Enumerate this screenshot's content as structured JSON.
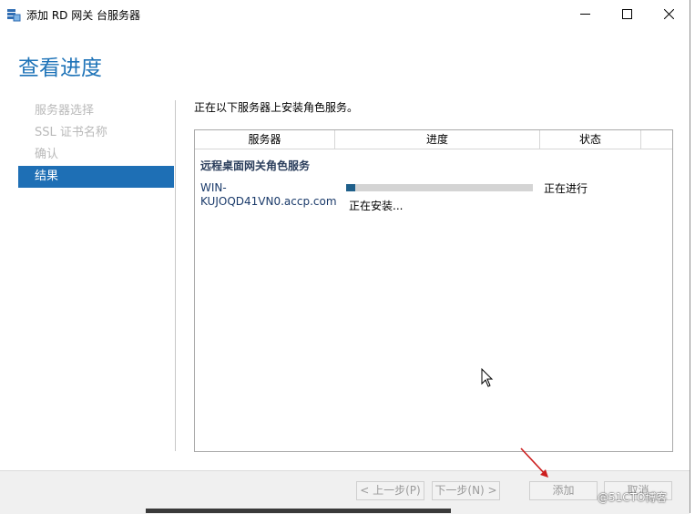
{
  "window": {
    "title": "添加 RD 网关 台服务器"
  },
  "page_title": "查看进度",
  "nav": {
    "items": [
      {
        "label": "服务器选择",
        "active": false
      },
      {
        "label": "SSL 证书名称",
        "active": false
      },
      {
        "label": "确认",
        "active": false
      },
      {
        "label": "结果",
        "active": true
      }
    ]
  },
  "intro": "正在以下服务器上安装角色服务。",
  "table": {
    "headers": [
      "服务器",
      "进度",
      "状态"
    ],
    "group": "远程桌面网关角色服务",
    "rows": [
      {
        "server": "WIN-KUJOQD41VN0.accp.com",
        "progress_fraction": 0.05,
        "progress_label": "正在安装...",
        "status": "正在进行"
      }
    ]
  },
  "footer": {
    "prev": "< 上一步(P)",
    "next": "下一步(N) >",
    "add": "添加",
    "cancel": "取消"
  },
  "watermark": "@51CTO博客",
  "colors": {
    "accent": "#1e73b8",
    "nav_active": "#1e6fb5",
    "progress": "#1e5f8a"
  }
}
